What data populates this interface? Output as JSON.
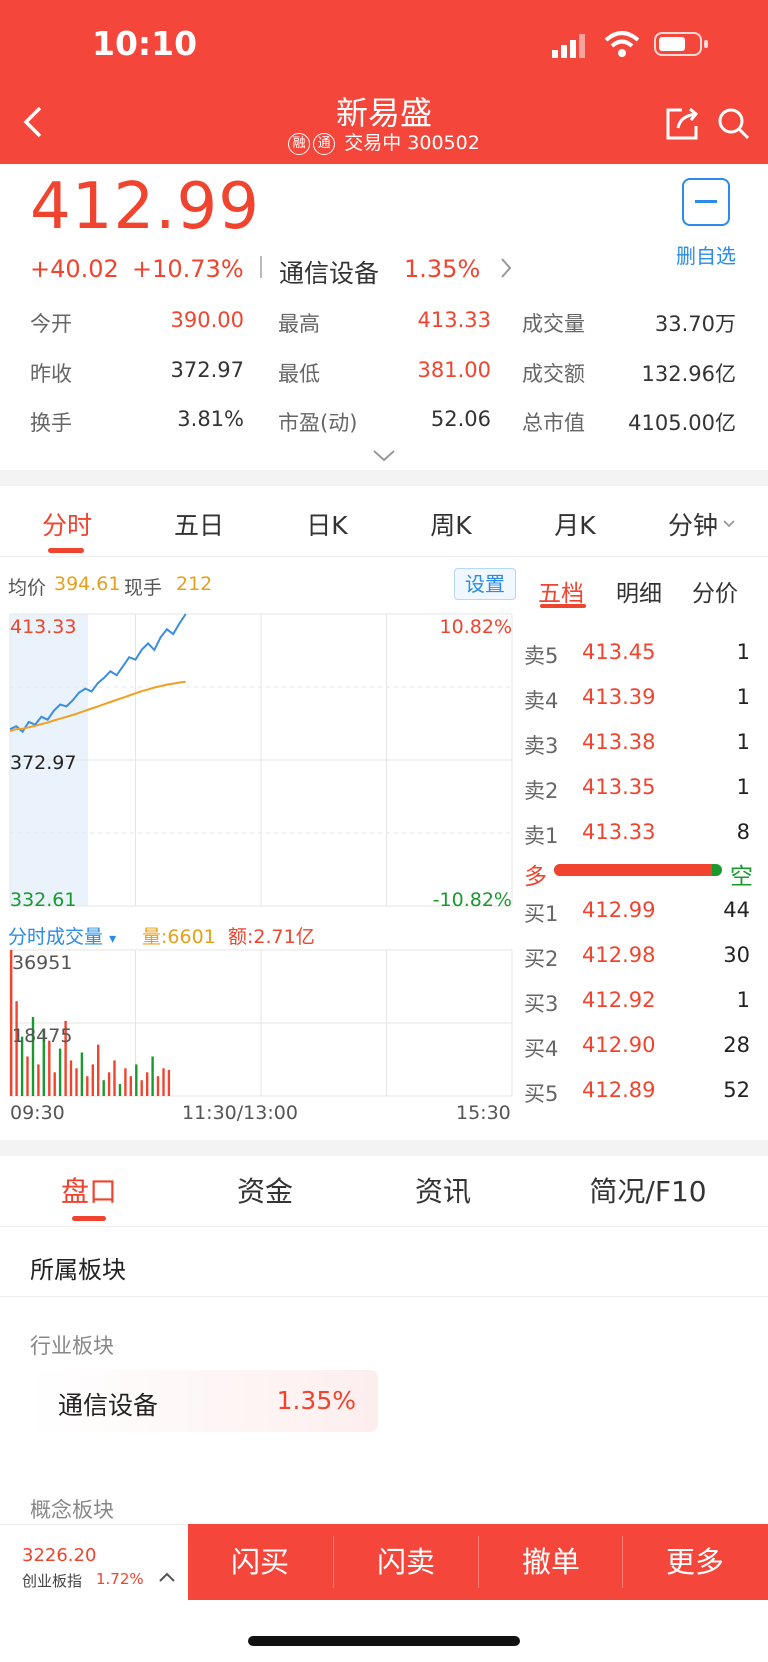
{
  "status_bar": {
    "time": "10:10"
  },
  "header": {
    "title": "新易盛",
    "badges": [
      "融",
      "通"
    ],
    "status": "交易中",
    "code": "300502"
  },
  "quote": {
    "price": "412.99",
    "change": "+40.02",
    "change_pct": "+10.73%",
    "sector_name": "通信设备",
    "sector_pct": "1.35%",
    "watch_label": "删自选",
    "stats": [
      {
        "label": "今开",
        "value": "390.00"
      },
      {
        "label": "最高",
        "value": "413.33"
      },
      {
        "label": "成交量",
        "value": "33.70万"
      },
      {
        "label": "昨收",
        "value": "372.97"
      },
      {
        "label": "最低",
        "value": "381.00"
      },
      {
        "label": "成交额",
        "value": "132.96亿"
      },
      {
        "label": "换手",
        "value": "3.81%"
      },
      {
        "label": "市盈(动)",
        "value": "52.06"
      },
      {
        "label": "总市值",
        "value": "4105.00亿"
      }
    ]
  },
  "chart_tabs": [
    "分时",
    "五日",
    "日K",
    "周K",
    "月K",
    "分钟"
  ],
  "intraday": {
    "avg_label": "均价",
    "avg_value": "394.61",
    "now_label": "现手",
    "now_value": "212",
    "settings_label": "设置",
    "y_max": "413.33",
    "y_mid": "372.97",
    "y_min": "332.61",
    "pct_max": "10.82%",
    "pct_min": "-10.82%",
    "vol_label": "分时成交量",
    "vol_arrow": "▾",
    "vol_qty": "量:6601",
    "vol_amt": "额:2.71亿",
    "vol_max": "36951",
    "vol_mid": "18475",
    "time_ticks": [
      "09:30",
      "11:30/13:00",
      "15:30"
    ]
  },
  "chart_data": {
    "type": "line",
    "x_range": [
      "09:30",
      "15:30"
    ],
    "ylim": [
      332.61,
      413.33
    ],
    "series": [
      {
        "name": "",
        "color": "#3a8de0",
        "values": [
          381.5,
          382.3,
          380.8,
          383.5,
          382.7,
          384.9,
          384.1,
          386.6,
          388.3,
          387.8,
          389.5,
          391.6,
          392.7,
          391.9,
          394.2,
          395.7,
          397.5,
          396.4,
          398.9,
          401.4,
          400.7,
          403.5,
          405.2,
          403.4,
          406.9,
          409.1,
          407.8,
          410.7,
          413.33
        ]
      },
      {
        "name": "",
        "color": "#f0a020",
        "values": [
          381.0,
          381.5,
          381.6,
          382.0,
          382.4,
          382.9,
          383.3,
          383.9,
          384.4,
          384.9,
          385.4,
          386.0,
          386.6,
          387.2,
          387.8,
          388.4,
          389.0,
          389.6,
          390.2,
          390.8,
          391.4,
          392.0,
          392.5,
          393.0,
          393.4,
          393.8,
          394.1,
          394.4,
          394.61
        ]
      }
    ],
    "volume": [
      36951,
      24000,
      15000,
      10000,
      20000,
      8000,
      17000,
      14000,
      6000,
      12000,
      19000,
      9000,
      7000,
      11000,
      5000,
      8000,
      13000,
      4000,
      6000,
      9000,
      3000,
      7000,
      5000,
      8000,
      4000,
      6000,
      10000,
      5000,
      7000,
      6601
    ],
    "volume_ylim": [
      0,
      36951
    ]
  },
  "orderbook": {
    "tabs": [
      "五档",
      "明细",
      "分价"
    ],
    "asks": [
      {
        "label": "卖5",
        "price": "413.45",
        "qty": "1"
      },
      {
        "label": "卖4",
        "price": "413.39",
        "qty": "1"
      },
      {
        "label": "卖3",
        "price": "413.38",
        "qty": "1"
      },
      {
        "label": "卖2",
        "price": "413.35",
        "qty": "1"
      },
      {
        "label": "卖1",
        "price": "413.33",
        "qty": "8"
      }
    ],
    "bull_label": "多",
    "bear_label": "空",
    "bull_ratio": 0.94,
    "bids": [
      {
        "label": "买1",
        "price": "412.99",
        "qty": "44"
      },
      {
        "label": "买2",
        "price": "412.98",
        "qty": "30"
      },
      {
        "label": "买3",
        "price": "412.92",
        "qty": "1"
      },
      {
        "label": "买4",
        "price": "412.90",
        "qty": "28"
      },
      {
        "label": "买5",
        "price": "412.89",
        "qty": "52"
      }
    ]
  },
  "bottom_tabs": [
    "盘口",
    "资金",
    "资讯",
    "简况/F10"
  ],
  "sections": {
    "board_title": "所属板块",
    "industry_label": "行业板块",
    "industry_name": "通信设备",
    "industry_pct": "1.35%",
    "concept_label": "概念板块"
  },
  "footer": {
    "index_value": "3226.20",
    "index_name": "创业板指",
    "index_pct": "1.72%",
    "buttons": [
      "闪买",
      "闪卖",
      "撤单",
      "更多"
    ]
  }
}
